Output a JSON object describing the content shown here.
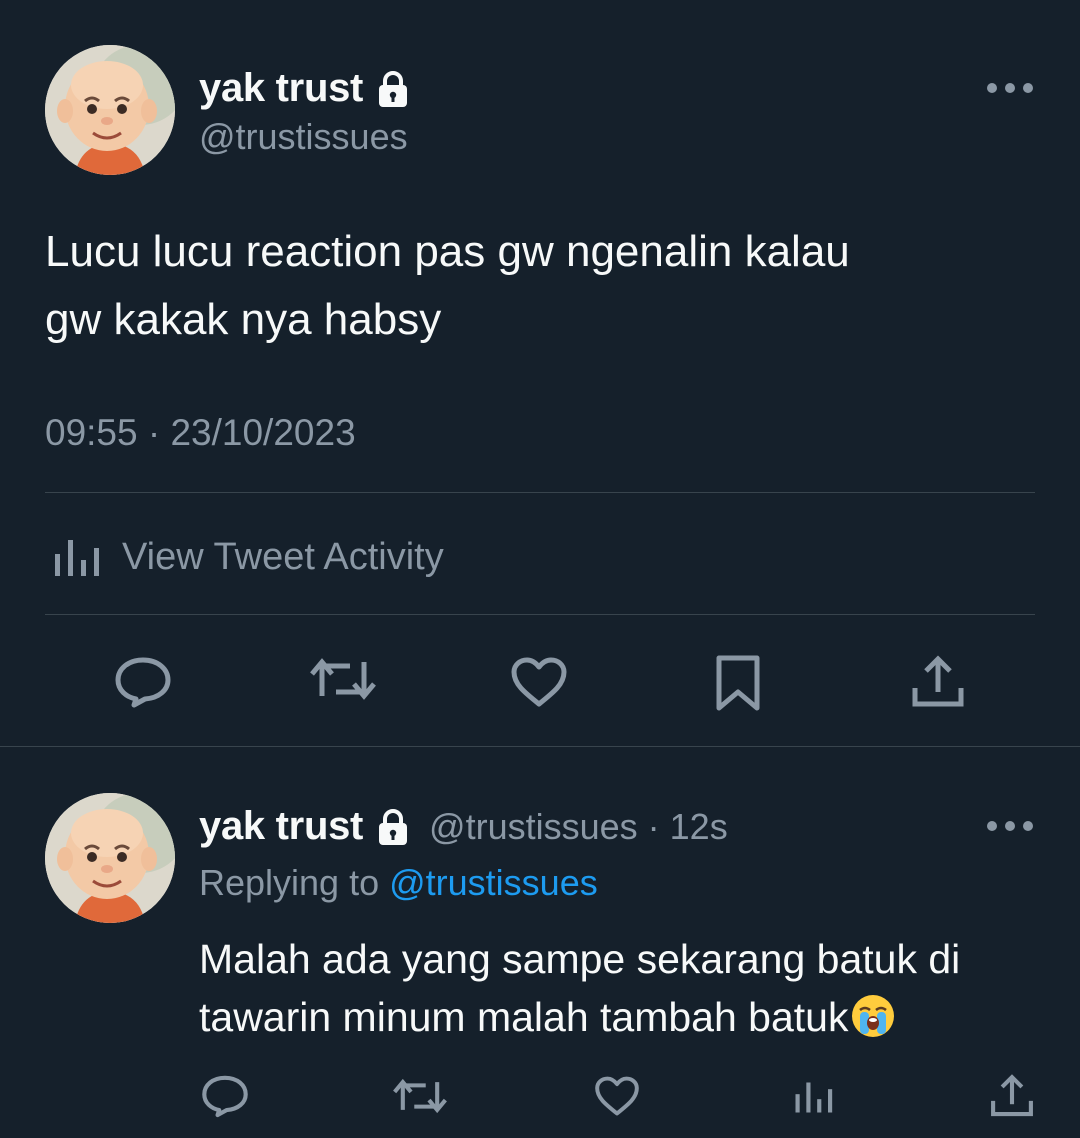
{
  "main_tweet": {
    "author": {
      "display_name": "yak trust",
      "handle": "@trustissues",
      "avatar_icon": "cartoon-boy-avatar",
      "protected_icon": "lock-icon"
    },
    "text": "Lucu lucu reaction pas gw ngenalin kalau\ngw kakak nya habsy",
    "timestamp": "09:55 · 23/10/2023",
    "activity_label": "View Tweet Activity",
    "actions": [
      "reply-icon",
      "retweet-icon",
      "like-icon",
      "bookmark-icon",
      "share-icon"
    ]
  },
  "reply_tweet": {
    "author": {
      "display_name": "yak trust",
      "handle": "@trustissues",
      "time_ago": "· 12s",
      "avatar_icon": "cartoon-boy-avatar"
    },
    "replying_prefix": "Replying to",
    "replying_to": "@trustissues",
    "text": "Malah ada yang sampe sekarang batuk di\ntawarin minum malah tambah batuk",
    "emoji": "loudly-crying-face",
    "actions": [
      "reply-icon",
      "retweet-icon",
      "like-icon",
      "views-icon",
      "share-icon"
    ]
  },
  "colors": {
    "background": "#15202b",
    "text": "#f7f9f9",
    "secondary": "#8b98a5",
    "link": "#1d9bf0",
    "divider": "#38444d"
  }
}
